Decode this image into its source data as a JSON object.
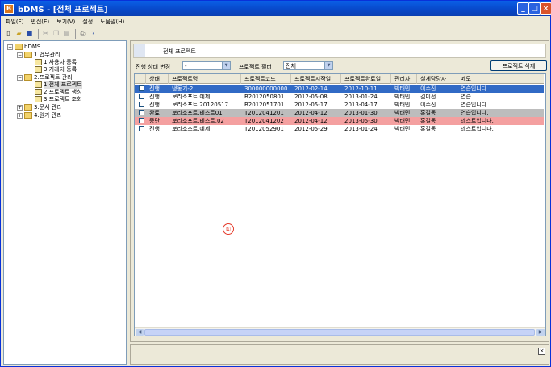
{
  "window": {
    "title": "bDMS - [전체 프로젝트]",
    "logo": "B"
  },
  "menu": [
    "파일(F)",
    "편집(E)",
    "보기(V)",
    "설정",
    "도움말(H)"
  ],
  "toolbar": [
    "new-icon",
    "open-icon",
    "save-icon",
    "cut-icon",
    "copy-icon",
    "paste-icon",
    "print-icon",
    "help-icon"
  ],
  "tree": {
    "root": "bDMS",
    "items": [
      {
        "label": "1.업무관리"
      },
      {
        "label": "1.사용자 등록"
      },
      {
        "label": "3.거래처 등록"
      },
      {
        "label": "2.프로젝트 관리"
      },
      {
        "label": "1.전체 프로젝트"
      },
      {
        "label": "2.프로젝트 생성"
      },
      {
        "label": "3.프로젝트 조회"
      },
      {
        "label": "3.문서 관리"
      },
      {
        "label": "4.원가 관리"
      }
    ]
  },
  "main": {
    "header_title": "전체 프로젝트",
    "filter": {
      "status_label": "진행 상태 변경",
      "status_value": "-",
      "project_filter_label": "프로젝트 필터",
      "project_filter_value": "전체",
      "delete_button": "프로젝트 삭제"
    },
    "annotation": "①"
  },
  "grid": {
    "columns": [
      "",
      "상태",
      "프로젝트명",
      "프로젝트코드",
      "프로젝트시작일",
      "프로젝트완료일",
      "관리자",
      "설계담당자",
      "메모"
    ],
    "rows": [
      {
        "status": "진행",
        "name": "냉동기-2",
        "code": "300000000000...",
        "start": "2012-02-14",
        "end": "2012-10-11",
        "manager": "박태민",
        "designer": "이수진",
        "memo": "연습입니다.",
        "color": "#316ac5",
        "text": "#ffffff"
      },
      {
        "status": "진행",
        "name": "보리소프트.예제",
        "code": "B2012050801",
        "start": "2012-05-08",
        "end": "2013-01-24",
        "manager": "박태민",
        "designer": "김미선",
        "memo": "연습",
        "color": "#ffffff",
        "text": "#000000"
      },
      {
        "status": "진행",
        "name": "보리소프트.20120517",
        "code": "B2012051701",
        "start": "2012-05-17",
        "end": "2013-04-17",
        "manager": "박태민",
        "designer": "이수진",
        "memo": "연습입니다.",
        "color": "#ffffff",
        "text": "#000000"
      },
      {
        "status": "완료",
        "name": "보리소프트.테스트01",
        "code": "T2012041201",
        "start": "2012-04-12",
        "end": "2013-01-30",
        "manager": "박태민",
        "designer": "홍길동",
        "memo": "연습입니다.",
        "color": "#bdbdbd",
        "text": "#000000"
      },
      {
        "status": "중단",
        "name": "보리소프트.테스트.02",
        "code": "T2012041202",
        "start": "2012-04-12",
        "end": "2013-05-30",
        "manager": "박태민",
        "designer": "홍길동",
        "memo": "테스트입니다.",
        "color": "#f4a0a0",
        "text": "#000000"
      },
      {
        "status": "진행",
        "name": "보리소스트.예제",
        "code": "T2012052901",
        "start": "2012-05-29",
        "end": "2013-01-24",
        "manager": "박태민",
        "designer": "홍길동",
        "memo": "테스트입니다.",
        "color": "#ffffff",
        "text": "#000000"
      }
    ]
  }
}
